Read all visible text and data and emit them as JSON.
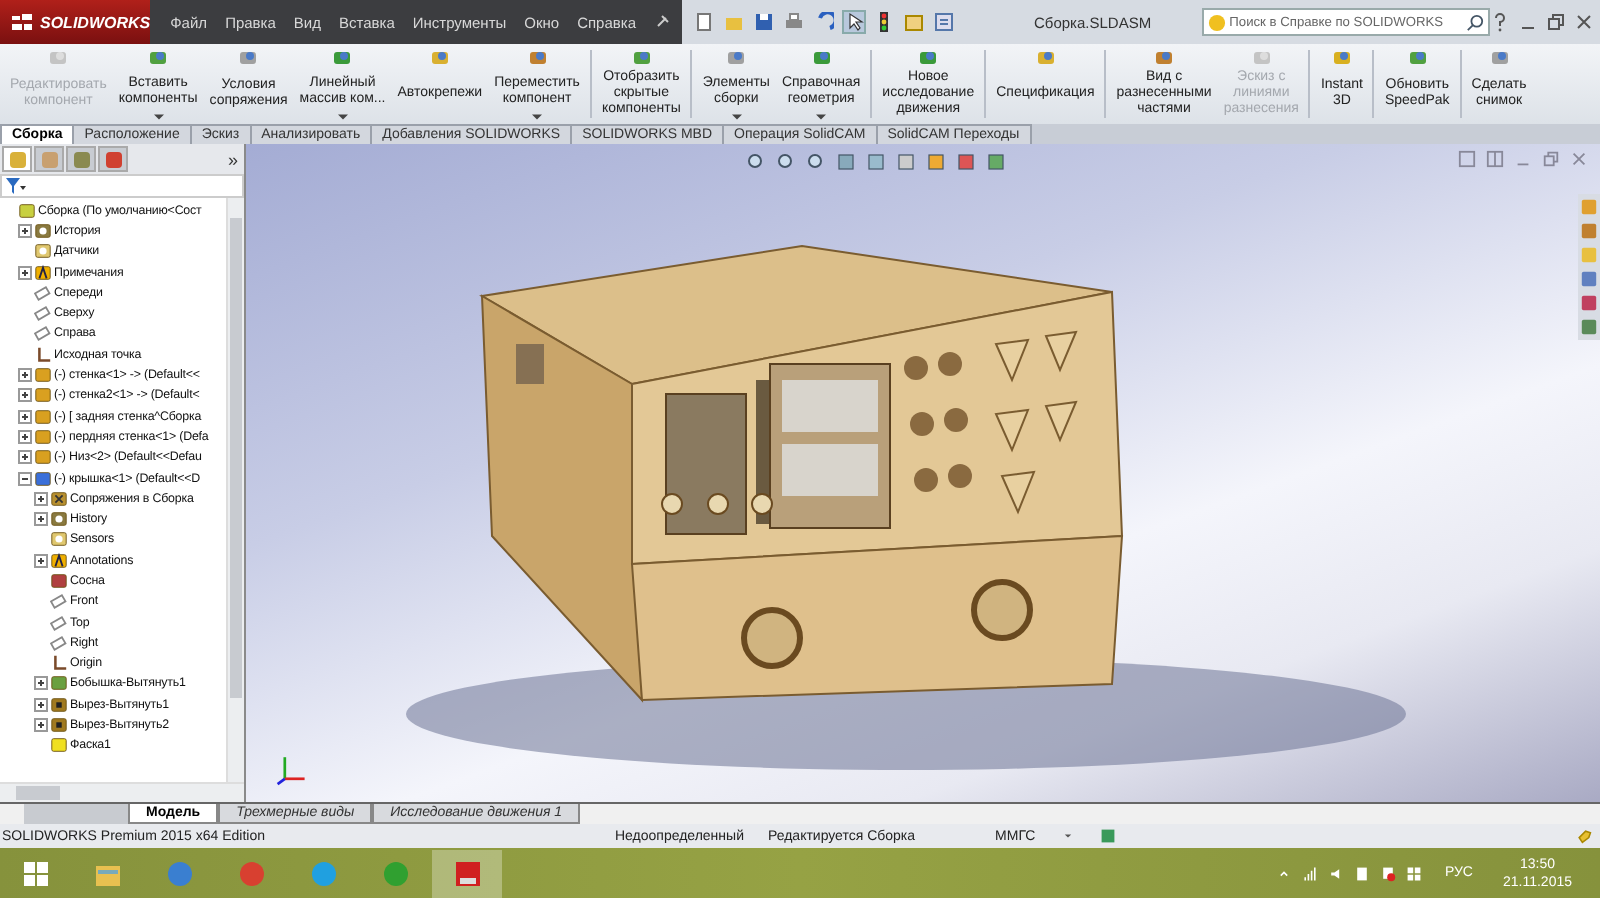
{
  "window": {
    "app_name": "SOLIDWORKS",
    "title": "Сборка.SLDASM",
    "menu": [
      "Файл",
      "Правка",
      "Вид",
      "Вставка",
      "Инструменты",
      "Окно",
      "Справка"
    ],
    "search": {
      "placeholder": "Поиск в Справке по SOLIDWORKS"
    }
  },
  "ribbon": {
    "groups": [
      [
        {
          "lines": [
            "Редактировать",
            "компонент"
          ],
          "disabled": true,
          "has_menu": false
        },
        {
          "lines": [
            "Вставить",
            "компоненты"
          ],
          "disabled": false,
          "has_menu": true
        },
        {
          "lines": [
            "Условия",
            "сопряжения"
          ],
          "disabled": false,
          "has_menu": false
        },
        {
          "lines": [
            "Линейный",
            "массив ком..."
          ],
          "disabled": false,
          "has_menu": true
        },
        {
          "lines": [
            "Автокрепежи"
          ],
          "disabled": false,
          "has_menu": false
        },
        {
          "lines": [
            "Переместить",
            "компонент"
          ],
          "disabled": false,
          "has_menu": true
        }
      ],
      [
        {
          "lines": [
            "Отобразить",
            "скрытые",
            "компоненты"
          ],
          "disabled": false,
          "has_menu": false
        }
      ],
      [
        {
          "lines": [
            "Элементы",
            "сборки"
          ],
          "disabled": false,
          "has_menu": true
        },
        {
          "lines": [
            "Справочная",
            "геометрия"
          ],
          "disabled": false,
          "has_menu": true
        }
      ],
      [
        {
          "lines": [
            "Новое",
            "исследование",
            "движения"
          ],
          "disabled": false,
          "has_menu": false
        }
      ],
      [
        {
          "lines": [
            "Спецификация"
          ],
          "disabled": false,
          "has_menu": false
        }
      ],
      [
        {
          "lines": [
            "Вид с",
            "разнесенными",
            "частями"
          ],
          "disabled": false,
          "has_menu": false
        },
        {
          "lines": [
            "Эскиз с",
            "линиями",
            "разнесения"
          ],
          "disabled": true,
          "has_menu": false
        }
      ],
      [
        {
          "lines": [
            "Instant",
            "3D"
          ],
          "disabled": false,
          "has_menu": false
        }
      ],
      [
        {
          "lines": [
            "Обновить",
            "SpeedPak"
          ],
          "disabled": false,
          "has_menu": false
        }
      ],
      [
        {
          "lines": [
            "Сделать",
            "снимок"
          ],
          "disabled": false,
          "has_menu": false
        }
      ]
    ]
  },
  "tabs": [
    {
      "label": "Сборка",
      "selected": true
    },
    {
      "label": "Расположение",
      "selected": false
    },
    {
      "label": "Эскиз",
      "selected": false
    },
    {
      "label": "Анализировать",
      "selected": false
    },
    {
      "label": "Добавления SOLIDWORKS",
      "selected": false
    },
    {
      "label": "SOLIDWORKS MBD",
      "selected": false
    },
    {
      "label": "Операция SolidCAM",
      "selected": false
    },
    {
      "label": "SolidCAM Переходы",
      "selected": false
    }
  ],
  "panel": {
    "tabs": [
      {
        "kind": "tree",
        "selected": true
      },
      {
        "kind": "properties",
        "selected": false
      },
      {
        "kind": "configurations",
        "selected": false
      },
      {
        "kind": "display",
        "selected": false
      }
    ],
    "expand_label": "»"
  },
  "tree": {
    "items": [
      {
        "label": "Сборка  (По умолчанию<Сост",
        "kind": "assembly",
        "children": [
          {
            "label": "История",
            "kind": "history",
            "expanded": false
          },
          {
            "label": "Датчики",
            "kind": "sensor"
          },
          {
            "label": "Примечания",
            "kind": "annotation",
            "expanded": false
          },
          {
            "label": "Спереди",
            "kind": "plane"
          },
          {
            "label": "Сверху",
            "kind": "plane"
          },
          {
            "label": "Справа",
            "kind": "plane"
          },
          {
            "label": "Исходная точка",
            "kind": "origin"
          },
          {
            "label": "(-) стенка<1> -> (Default<<",
            "kind": "part",
            "expanded": false
          },
          {
            "label": "(-) стенка2<1> -> (Default<",
            "kind": "part",
            "expanded": false
          },
          {
            "label": "(-) [ задняя стенка^Сборка",
            "kind": "part",
            "expanded": false
          },
          {
            "label": "(-) пердняя стенка<1> (Defa",
            "kind": "part",
            "expanded": false
          },
          {
            "label": "(-) Низ<2> (Default<<Defau",
            "kind": "part",
            "expanded": false
          },
          {
            "label": "(-) крышка<1> (Default<<D",
            "kind": "edited_part",
            "expanded": true,
            "children": [
              {
                "label": "Сопряжения в Сборка",
                "kind": "mates",
                "expanded": false
              },
              {
                "label": "History",
                "kind": "history",
                "expanded": false
              },
              {
                "label": "Sensors",
                "kind": "sensor"
              },
              {
                "label": "Annotations",
                "kind": "annotation",
                "expanded": false
              },
              {
                "label": "Сосна",
                "kind": "material"
              },
              {
                "label": "Front",
                "kind": "plane"
              },
              {
                "label": "Top",
                "kind": "plane"
              },
              {
                "label": "Right",
                "kind": "plane"
              },
              {
                "label": "Origin",
                "kind": "origin"
              },
              {
                "label": "Бобышка-Вытянуть1",
                "kind": "boss",
                "expanded": false
              },
              {
                "label": "Вырез-Вытянуть1",
                "kind": "cut",
                "expanded": false
              },
              {
                "label": "Вырез-Вытянуть2",
                "kind": "cut",
                "expanded": false
              },
              {
                "label": "Фаска1",
                "kind": "chamfer"
              }
            ]
          }
        ]
      }
    ]
  },
  "bottom_tabs": [
    {
      "label": "Модель",
      "selected": true
    },
    {
      "label": "Трехмерные виды",
      "selected": false
    },
    {
      "label": "Исследование движения 1",
      "selected": false
    }
  ],
  "status_bar": {
    "edition": "SOLIDWORKS Premium 2015 x64 Edition",
    "state": "Недоопределенный",
    "mode": "Редактируется Сборка",
    "units": "ММГС"
  },
  "taskbar": {
    "apps": [
      {
        "kind": "start",
        "selected": false
      },
      {
        "kind": "explorer",
        "selected": false
      },
      {
        "kind": "disc",
        "selected": false
      },
      {
        "kind": "browser",
        "selected": false
      },
      {
        "kind": "messenger",
        "selected": false
      },
      {
        "kind": "green",
        "selected": false
      },
      {
        "kind": "cad",
        "selected": true
      }
    ],
    "language": "РУС",
    "time": "13:50",
    "date": "21.11.2015"
  }
}
